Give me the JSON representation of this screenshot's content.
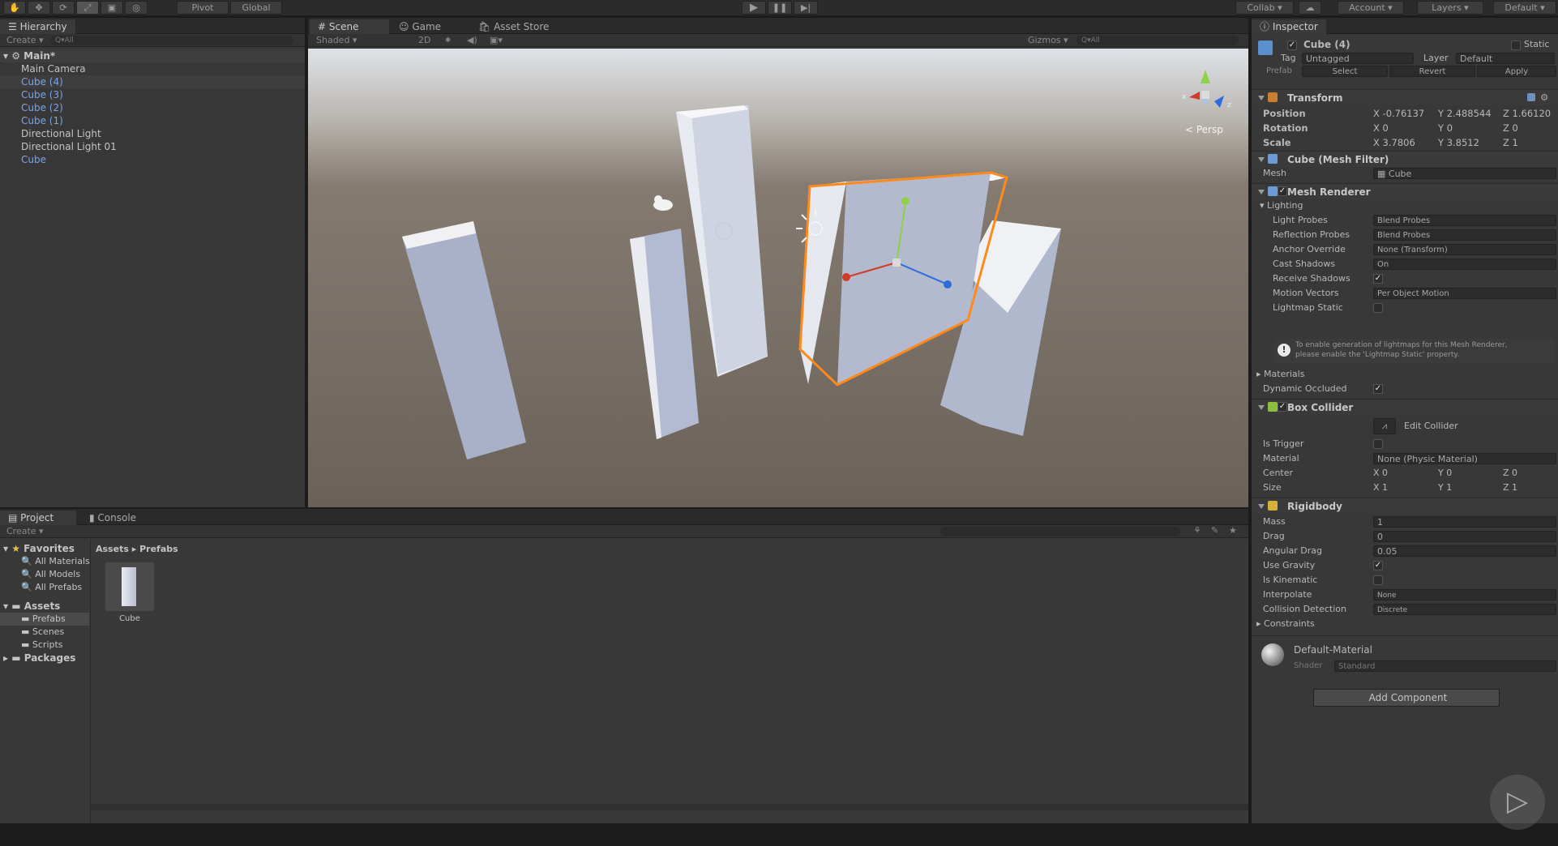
{
  "toolbar": {
    "pivot": "Pivot",
    "global": "Global",
    "collab": "Collab",
    "account": "Account",
    "layers": "Layers",
    "layout": "Default"
  },
  "hierarchy": {
    "tab": "Hierarchy",
    "create": "Create",
    "search": "Q▾All",
    "scene": "Main*",
    "items": [
      {
        "label": "Main Camera",
        "prefab": false,
        "selected": false
      },
      {
        "label": "Cube (4)",
        "prefab": true,
        "selected": true
      },
      {
        "label": "Cube (3)",
        "prefab": true,
        "selected": false
      },
      {
        "label": "Cube (2)",
        "prefab": true,
        "selected": false
      },
      {
        "label": "Cube (1)",
        "prefab": true,
        "selected": false
      },
      {
        "label": "Directional Light",
        "prefab": false,
        "selected": false
      },
      {
        "label": "Directional Light 01",
        "prefab": false,
        "selected": false
      },
      {
        "label": "Cube",
        "prefab": true,
        "selected": false
      }
    ]
  },
  "scene_view": {
    "tabs": [
      "Scene",
      "Game",
      "Asset Store"
    ],
    "shading": "Shaded",
    "mode_2d": "2D",
    "gizmos": "Gizmos",
    "search": "Q▾All",
    "persp": "< Persp"
  },
  "project": {
    "tabs": [
      "Project",
      "Console"
    ],
    "create": "Create",
    "favorites_label": "Favorites",
    "favorites": [
      "All Materials",
      "All Models",
      "All Prefabs"
    ],
    "assets_label": "Assets",
    "asset_folders": [
      "Prefabs",
      "Scenes",
      "Scripts"
    ],
    "packages_label": "Packages",
    "breadcrumb_root": "Assets",
    "breadcrumb_sep": "▸",
    "breadcrumb_leaf": "Prefabs",
    "asset_item": "Cube"
  },
  "inspector": {
    "tab": "Inspector",
    "object_name": "Cube (4)",
    "static": "Static",
    "tag_label": "Tag",
    "tag_value": "Untagged",
    "layer_label": "Layer",
    "layer_value": "Default",
    "prefab_label": "Prefab",
    "prefab_select": "Select",
    "prefab_revert": "Revert",
    "prefab_apply": "Apply",
    "transform": {
      "title": "Transform",
      "position_label": "Position",
      "position": {
        "x": "-0.76137",
        "y": "2.488544",
        "z": "1.66120"
      },
      "rotation_label": "Rotation",
      "rotation": {
        "x": "0",
        "y": "0",
        "z": "0"
      },
      "scale_label": "Scale",
      "scale": {
        "x": "3.7806",
        "y": "3.8512",
        "z": "1"
      }
    },
    "mesh_filter": {
      "title": "Cube (Mesh Filter)",
      "mesh_label": "Mesh",
      "mesh_value": "Cube"
    },
    "mesh_renderer": {
      "title": "Mesh Renderer",
      "lighting": "Lighting",
      "light_probes_label": "Light Probes",
      "light_probes": "Blend Probes",
      "reflection_probes_label": "Reflection Probes",
      "reflection_probes": "Blend Probes",
      "anchor_label": "Anchor Override",
      "anchor": "None (Transform)",
      "cast_shadows_label": "Cast Shadows",
      "cast_shadows": "On",
      "receive_shadows_label": "Receive Shadows",
      "motion_vectors_label": "Motion Vectors",
      "motion_vectors": "Per Object Motion",
      "lightmap_static_label": "Lightmap Static",
      "info_line1": "To enable generation of lightmaps for this Mesh Renderer,",
      "info_line2": "please enable the 'Lightmap Static' property.",
      "materials": "Materials",
      "dynamic_occluded_label": "Dynamic Occluded"
    },
    "box_collider": {
      "title": "Box Collider",
      "edit_collider": "Edit Collider",
      "is_trigger_label": "Is Trigger",
      "material_label": "Material",
      "material": "None (Physic Material)",
      "center_label": "Center",
      "center": {
        "x": "0",
        "y": "0",
        "z": "0"
      },
      "size_label": "Size",
      "size": {
        "x": "1",
        "y": "1",
        "z": "1"
      }
    },
    "rigidbody": {
      "title": "Rigidbody",
      "mass_label": "Mass",
      "mass": "1",
      "drag_label": "Drag",
      "drag": "0",
      "angular_drag_label": "Angular Drag",
      "angular_drag": "0.05",
      "use_gravity_label": "Use Gravity",
      "is_kinematic_label": "Is Kinematic",
      "interpolate_label": "Interpolate",
      "interpolate": "None",
      "collision_label": "Collision Detection",
      "collision": "Discrete",
      "constraints": "Constraints"
    },
    "material": {
      "name": "Default-Material",
      "shader_label": "Shader",
      "shader": "Standard"
    },
    "add_component": "Add Component"
  },
  "colors": {
    "selection": "#ff8a1c",
    "prefab_blue": "#7aa4e6",
    "scene_bg_top": "#d8dde4",
    "scene_ground": "#6e665d"
  }
}
